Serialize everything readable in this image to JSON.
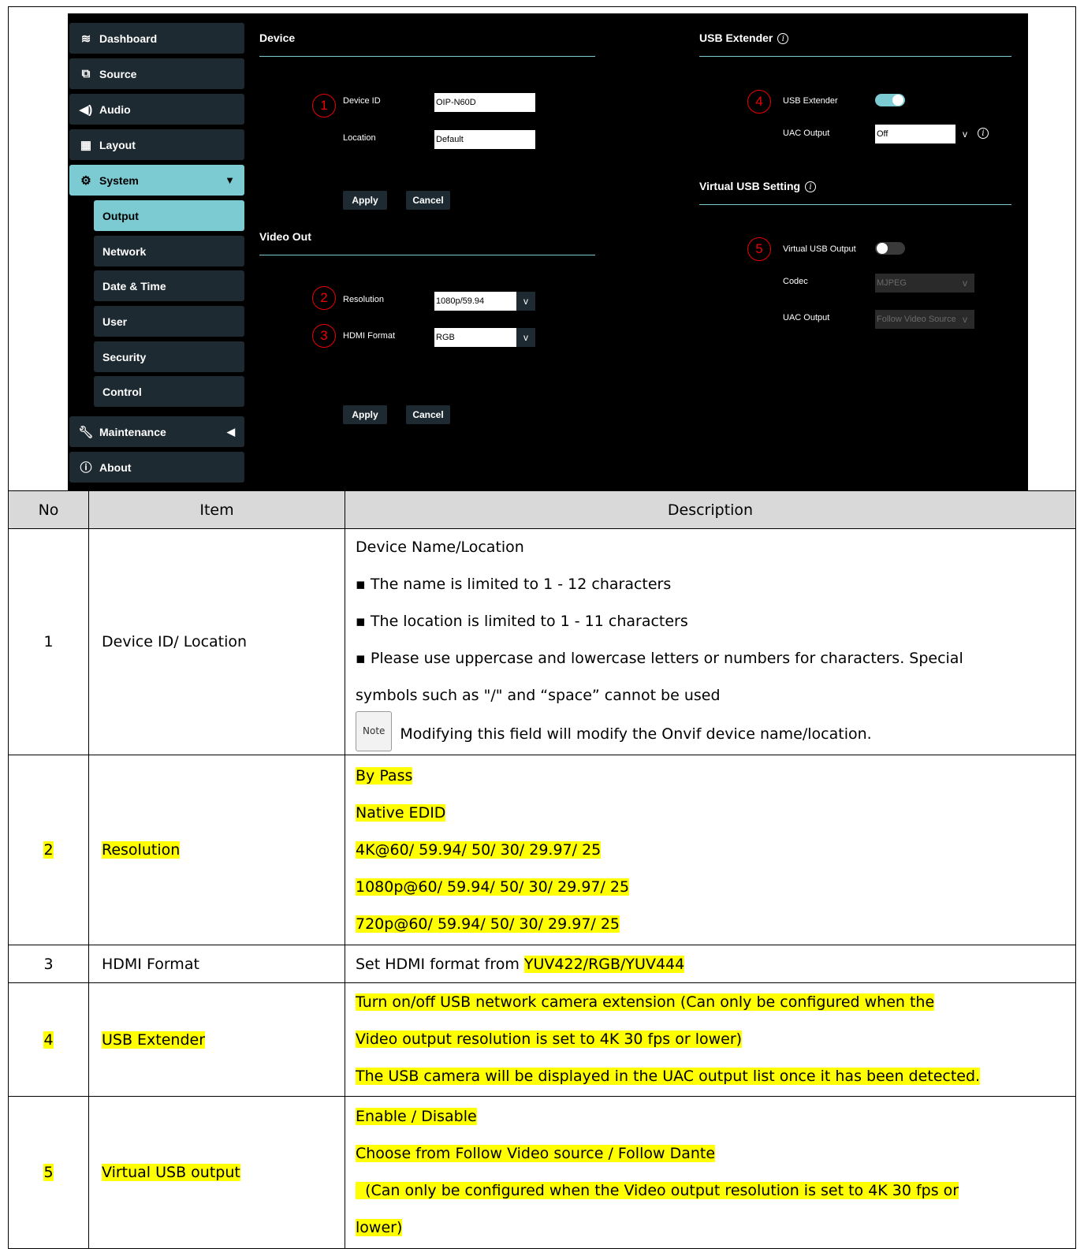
{
  "sidebar": {
    "items": [
      {
        "label": "Dashboard",
        "icon": "layers-icon"
      },
      {
        "label": "Source",
        "icon": "source-icon"
      },
      {
        "label": "Audio",
        "icon": "speaker-icon"
      },
      {
        "label": "Layout",
        "icon": "grid-icon"
      },
      {
        "label": "System",
        "icon": "gear-icon",
        "caret": "▼"
      },
      {
        "label": "Maintenance",
        "icon": "wrench-icon",
        "caret": "◀"
      },
      {
        "label": "About",
        "icon": "info-icon"
      }
    ],
    "sub_items": [
      "Output",
      "Network",
      "Date & Time",
      "User",
      "Security",
      "Control"
    ]
  },
  "device": {
    "title": "Device",
    "device_id_label": "Device ID",
    "device_id_value": "OIP-N60D",
    "location_label": "Location",
    "location_value": "Default",
    "apply": "Apply",
    "cancel": "Cancel"
  },
  "video_out": {
    "title": "Video Out",
    "resolution_label": "Resolution",
    "resolution_value": "1080p/59.94",
    "hdmi_label": "HDMI Format",
    "hdmi_value": "RGB",
    "apply": "Apply",
    "cancel": "Cancel"
  },
  "usb_extender": {
    "title": "USB Extender",
    "toggle_label": "USB Extender",
    "toggle_state": "on",
    "uac_label": "UAC Output",
    "uac_value": "Off"
  },
  "virtual_usb": {
    "title": "Virtual USB Setting",
    "toggle_label": "Virtual USB Output",
    "toggle_state": "off",
    "codec_label": "Codec",
    "codec_value": "MJPEG",
    "uac_label": "UAC Output",
    "uac_value": "Follow Video Source"
  },
  "badges": [
    "1",
    "2",
    "3",
    "4",
    "5"
  ],
  "info_glyph": "i",
  "dropdown_glyph": "v",
  "table": {
    "headers": [
      "No",
      "Item",
      "Description"
    ],
    "rows": [
      {
        "no": "1",
        "item": "Device ID/ Location",
        "lines": [
          "Device Name/Location",
          "▪ The name is limited to 1 - 12 characters",
          "▪ The location is limited to 1 - 11 characters",
          "▪ Please use uppercase and lowercase letters or numbers for characters. Special",
          "symbols such as \"/\" and “space” cannot be used"
        ],
        "note_tag": "Note",
        "note_text": "Modifying this field will modify the Onvif device name/location."
      },
      {
        "no": "2",
        "item": "Resolution",
        "lines": [
          "By Pass",
          "Native EDID",
          "4K@60/ 59.94/ 50/ 30/ 29.97/ 25",
          "1080p@60/ 59.94/ 50/ 30/ 29.97/ 25",
          "720p@60/ 59.94/ 50/ 30/ 29.97/ 25"
        ]
      },
      {
        "no": "3",
        "item": "HDMI Format",
        "prefix": "Set HDMI format from ",
        "highlight": "YUV422/RGB/YUV444"
      },
      {
        "no": "4",
        "item": "USB Extender",
        "lines": [
          "Turn on/off USB network camera extension (Can only be configured when the",
          "Video output resolution is set to 4K 30 fps or lower)",
          "The USB camera will be displayed in the UAC output list once it has been detected."
        ]
      },
      {
        "no": "5",
        "item": "Virtual USB output",
        "lines": [
          "Enable / Disable",
          "Choose from Follow Video source / Follow Dante",
          "  (Can only be configured when the Video output resolution is set to 4K 30 fps or",
          "lower)"
        ]
      }
    ]
  },
  "colors": {
    "accent": "#7ccad2",
    "panel": "#1e2a31",
    "badge": "#e00000",
    "highlight": "#ffff00"
  }
}
